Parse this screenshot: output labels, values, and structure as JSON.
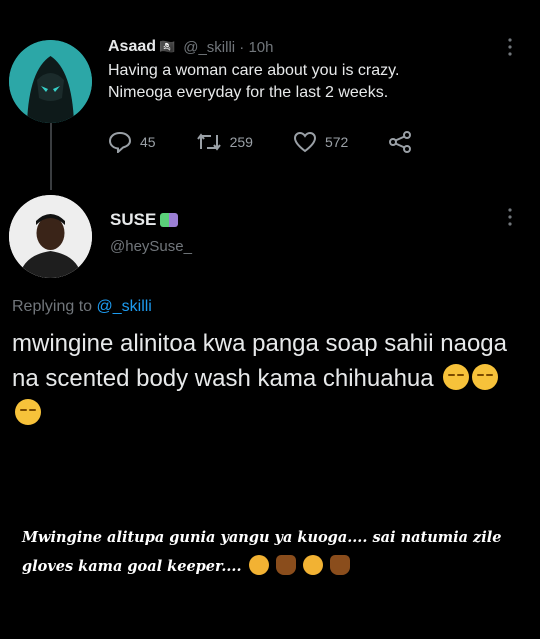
{
  "tweet1": {
    "name": "Asaad",
    "name_emoji": "🏴‍☠️",
    "handle": "@_skilli · 10h",
    "text_line1": "Having a woman care about you is crazy.",
    "text_line2": "Nimeoga everyday for the last 2 weeks.",
    "replies": "45",
    "retweets": "259",
    "likes": "572"
  },
  "tweet2": {
    "name": "SUSE",
    "handle": "@heySuse_",
    "replying_prefix": "Replying to ",
    "replying_handle": "@_skilli",
    "text": "mwingine alinitoa kwa panga soap sahii naoga na scented body wash kama chihuahua"
  },
  "caption": {
    "line1": "Mwingine alitupa gunia yangu ya kuoga.... sai natumia zile",
    "line2": "gloves kama goal keeper...."
  },
  "icons": [
    "reply-icon",
    "retweet-icon",
    "like-icon",
    "share-icon",
    "more-icon"
  ],
  "colors": {
    "background": "#000000",
    "link": "#1d9bf0",
    "muted": "#71767b"
  }
}
